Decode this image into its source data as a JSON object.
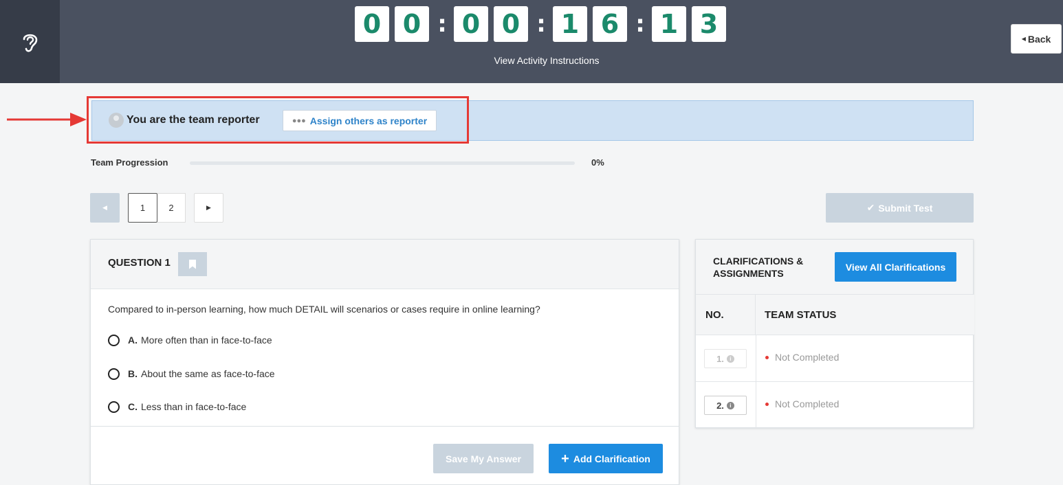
{
  "header": {
    "timer_digits": [
      "0",
      "0",
      "0",
      "0",
      "1",
      "6",
      "1",
      "3"
    ],
    "timer_separator": ":",
    "instructions_link": "View Activity Instructions",
    "back_label": "Back",
    "back_icon": "caret-left-icon",
    "logo_icon": "ear-icon"
  },
  "reporter": {
    "text": "You are the team reporter",
    "avatar_icon": "user-avatar-icon",
    "assign_label": "Assign others as reporter",
    "assign_icon": "team-icon"
  },
  "progress": {
    "label": "Team Progression",
    "value_text": "0%",
    "value": 0
  },
  "pagination": {
    "prev_icon": "caret-left-icon",
    "next_icon": "caret-right-icon",
    "pages": [
      "1",
      "2"
    ],
    "current_page": "1"
  },
  "submit": {
    "label": "Submit Test",
    "icon": "checkmark-icon"
  },
  "question": {
    "title": "QUESTION 1",
    "bookmark_icon": "bookmark-icon",
    "text": "Compared to in-person learning, how much DETAIL will scenarios or cases require in online learning?",
    "options": [
      {
        "letter": "A.",
        "text": "More often than in face-to-face"
      },
      {
        "letter": "B.",
        "text": "About the same as face-to-face"
      },
      {
        "letter": "C.",
        "text": "Less than in face-to-face"
      }
    ],
    "save_label": "Save My Answer",
    "add_clarification_label": "Add Clarification"
  },
  "clarifications": {
    "title": "CLARIFICATIONS & ASSIGNMENTS",
    "view_all_label": "View All Clarifications",
    "col_no": "NO.",
    "col_status": "TEAM STATUS",
    "rows": [
      {
        "no": "1.",
        "status": "Not Completed"
      },
      {
        "no": "2.",
        "status": "Not Completed"
      }
    ]
  },
  "colors": {
    "header_bg": "#4a5160",
    "timer_digit": "#1b8a6b",
    "primary_blue": "#1d8ce0",
    "disabled": "#c9d4de",
    "banner_bg": "#cfe1f3",
    "annotation_red": "#e53935"
  }
}
